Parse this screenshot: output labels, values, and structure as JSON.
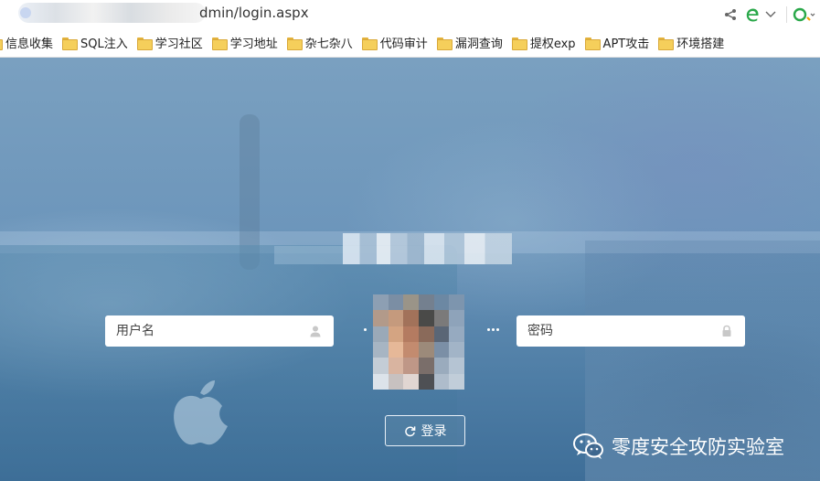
{
  "browser": {
    "url_suffix": "dmin/login.aspx",
    "share_icon": "share-icon",
    "engine_icon": "edge-e-icon",
    "search_icon": "search-icon"
  },
  "bookmarks": [
    {
      "label": "信息收集"
    },
    {
      "label": "SQL注入"
    },
    {
      "label": "学习社区"
    },
    {
      "label": "学习地址"
    },
    {
      "label": "杂七杂八"
    },
    {
      "label": "代码审计"
    },
    {
      "label": "漏洞查询"
    },
    {
      "label": "提权exp"
    },
    {
      "label": "APT攻击"
    },
    {
      "label": "环境搭建"
    }
  ],
  "login": {
    "username_placeholder": "用户名",
    "password_placeholder": "密码",
    "submit_label": "登录"
  },
  "watermark": {
    "text": "零度安全攻防实验室"
  },
  "colors": {
    "bg_top": "#7aa0c0",
    "bg_bottom": "#3e6e98",
    "field_bg": "#ffffff",
    "folder": "#f5cf5b"
  }
}
